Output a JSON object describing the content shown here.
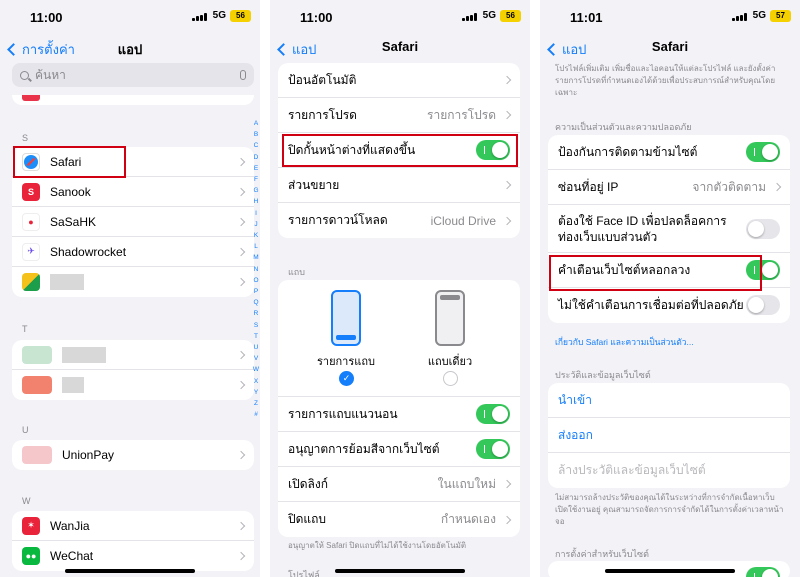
{
  "screen1": {
    "time": "11:00",
    "network": "5G",
    "battery": "56",
    "back": "การตั้งค่า",
    "title": "แอป",
    "search_placeholder": "ค้นหา",
    "sections": [
      "S",
      "T",
      "U",
      "W"
    ],
    "apps_s": [
      "Safari",
      "Sanook",
      "SaSaHK",
      "Shadowrocket"
    ],
    "apps_u": [
      "UnionPay"
    ],
    "apps_w": [
      "WanJia",
      "WeChat"
    ],
    "index": [
      "A",
      "B",
      "C",
      "D",
      "E",
      "F",
      "G",
      "H",
      "I",
      "J",
      "K",
      "L",
      "M",
      "N",
      "O",
      "P",
      "Q",
      "R",
      "S",
      "T",
      "U",
      "V",
      "W",
      "X",
      "Y",
      "Z",
      "#"
    ]
  },
  "screen2": {
    "time": "11:00",
    "network": "5G",
    "battery": "56",
    "back": "แอป",
    "title": "Safari",
    "rows": [
      {
        "label": "ป้อนอัตโนมัติ",
        "value": ""
      },
      {
        "label": "รายการโปรด",
        "value": "รายการโปรด"
      },
      {
        "label": "ปิดกั้นหน้าต่างที่แสดงขึ้น",
        "value": ""
      },
      {
        "label": "ส่วนขยาย",
        "value": ""
      },
      {
        "label": "รายการดาวน์โหลด",
        "value": "iCloud Drive"
      }
    ],
    "tabs_header": "แถบ",
    "tab_option1": "รายการแถบ",
    "tab_option2": "แถบเดี่ยว",
    "rows2": [
      {
        "label": "รายการแถบแนวนอน",
        "value": ""
      },
      {
        "label": "อนุญาตการย้อมสีจากเว็บไซต์",
        "value": ""
      },
      {
        "label": "เปิดลิงก์",
        "value": "ในแถบใหม่"
      },
      {
        "label": "ปิดแถบ",
        "value": "กำหนดเอง"
      }
    ],
    "footer": "อนุญาตให้ Safari ปิดแถบที่ไม่ได้ใช้งานโดยอัตโนมัติ",
    "next_header": "โปรไฟล์"
  },
  "screen3": {
    "time": "11:01",
    "network": "5G",
    "battery": "57",
    "back": "แอป",
    "title": "Safari",
    "top_note": "โปรไฟล์เพิ่มเติม เพิ่มชื่อและไอคอนให้แต่ละโปรไฟล์ และยังตั้งค่ารายการโปรดที่กำหนดเองได้ด้วยเพื่อประสบการณ์สำหรับคุณโดยเฉพาะ",
    "privacy_header": "ความเป็นส่วนตัวและความปลอดภัย",
    "privacy_rows": [
      {
        "label": "ป้องกันการติดตามข้ามไซต์",
        "value": ""
      },
      {
        "label": "ซ่อนที่อยู่ IP",
        "value": "จากตัวติดตาม"
      },
      {
        "label": "ต้องใช้ Face ID เพื่อปลดล็อคการท่องเว็บแบบส่วนตัว",
        "value": ""
      },
      {
        "label": "คำเตือนเว็บไซต์หลอกลวง",
        "value": ""
      },
      {
        "label": "ไม่ใช้คำเตือนการเชื่อมต่อที่ปลอดภัย",
        "value": ""
      }
    ],
    "privacy_link": "เกี่ยวกับ Safari และความเป็นส่วนตัว...",
    "history_header": "ประวัติและข้อมูลเว็บไซต์",
    "history_rows": [
      "นำเข้า",
      "ส่งออก",
      "ล้างประวัติและข้อมูลเว็บไซต์"
    ],
    "history_note": "ไม่สามารถล้างประวัติของคุณได้ในระหว่างที่การจำกัดเนื้อหาเว็บเปิดใช้งานอยู่ คุณสามารถจัดการการจำกัดได้ในการตั้งค่าเวลาหน้าจอ",
    "site_header": "การตั้งค่าสำหรับเว็บไซต์"
  },
  "colors": {
    "accent": "#147efb",
    "toggle_on": "#34c759",
    "highlight": "#d00012"
  }
}
